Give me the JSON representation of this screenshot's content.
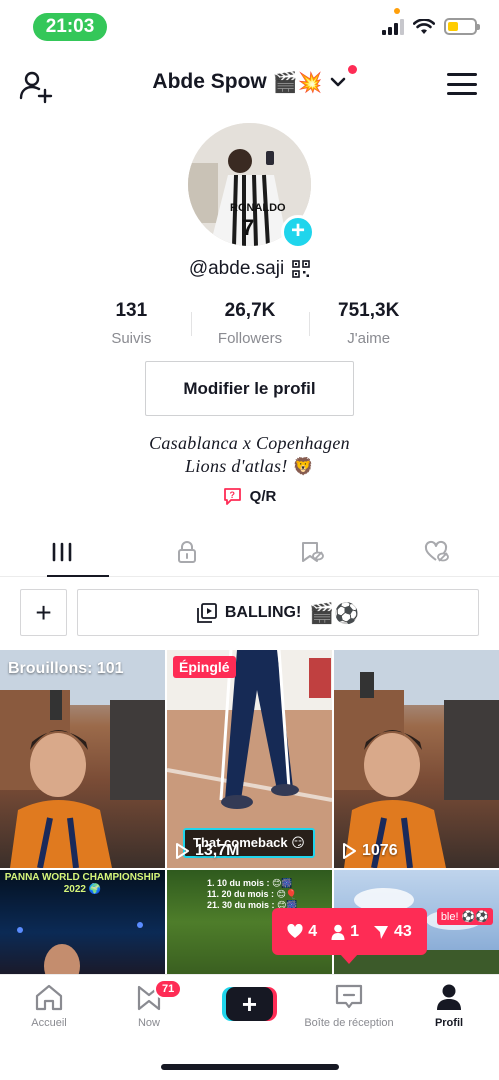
{
  "status_bar": {
    "time": "21:03"
  },
  "header": {
    "profile_name": "Abde Spow",
    "name_emojis": "🎬💥"
  },
  "profile": {
    "username": "@abde.saji",
    "stats": [
      {
        "value": "131",
        "label": "Suivis"
      },
      {
        "value": "26,7K",
        "label": "Followers"
      },
      {
        "value": "751,3K",
        "label": "J'aime"
      }
    ],
    "edit_button": "Modifier le profil",
    "bio_line1": "Casablanca x Copenhagen",
    "bio_line2": "Lions d'atlas!",
    "bio_emoji": "🦁",
    "qa_label": "Q/R"
  },
  "playlist": {
    "add_label": "+",
    "name": "BALLING!",
    "emojis": "🎬⚽"
  },
  "grid": {
    "drafts_label": "Brouillons: 101",
    "pinned_label": "Épinglé",
    "pinned_views": "13,7M",
    "pinned_caption": "That comeback 😏",
    "video3_views": "1076",
    "panna_title": "PANNA WORLD CHAMPIONSHIP 2022 🌍",
    "schedule": [
      "1.  10 du mois : 😊🎆",
      "11.  20 du mois : 😊🎈",
      "21.  30 du mois : 😊🎆"
    ],
    "sky_text": "ble! ⚽⚽"
  },
  "notifications": {
    "likes": "4",
    "followers": "1",
    "comments": "43"
  },
  "bottom_nav": {
    "home": "Accueil",
    "now": "Now",
    "now_badge": "71",
    "create": "+",
    "inbox": "Boîte de réception",
    "profile": "Profil"
  },
  "colors": {
    "accent_red": "#fe2c55",
    "accent_cyan": "#20d5ec",
    "status_green": "#34c759"
  }
}
